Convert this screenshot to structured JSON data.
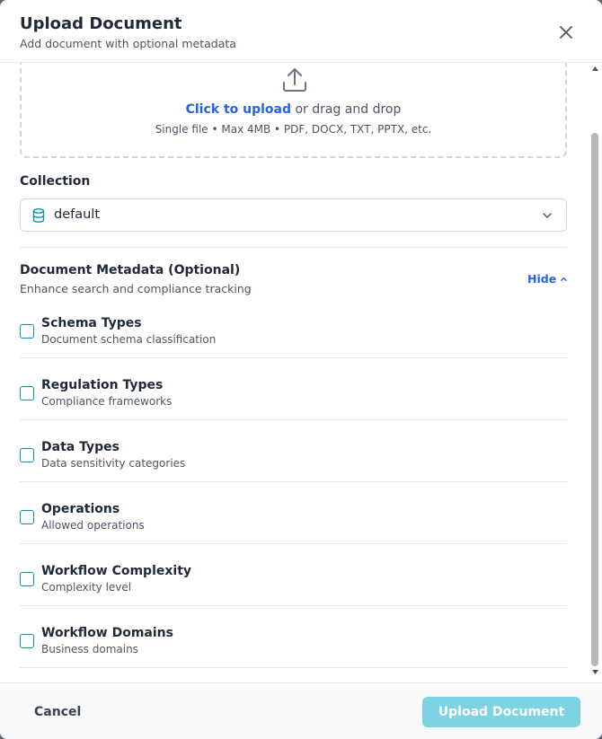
{
  "header": {
    "title": "Upload Document",
    "subtitle": "Add document with optional metadata"
  },
  "dropzone": {
    "link_text": "Click to upload",
    "rest_text": " or drag and drop",
    "hint": "Single file • Max 4MB • PDF, DOCX, TXT, PPTX, etc."
  },
  "collection": {
    "label": "Collection",
    "selected": "default"
  },
  "metadata": {
    "title": "Document Metadata (Optional)",
    "subtitle": "Enhance search and compliance tracking",
    "toggle_label": "Hide",
    "items": [
      {
        "name": "Schema Types",
        "desc": "Document schema classification",
        "checked": false
      },
      {
        "name": "Regulation Types",
        "desc": "Compliance frameworks",
        "checked": false
      },
      {
        "name": "Data Types",
        "desc": "Data sensitivity categories",
        "checked": false
      },
      {
        "name": "Operations",
        "desc": "Allowed operations",
        "checked": false
      },
      {
        "name": "Workflow Complexity",
        "desc": "Complexity level",
        "checked": false
      },
      {
        "name": "Workflow Domains",
        "desc": "Business domains",
        "checked": false
      }
    ]
  },
  "footer": {
    "cancel_label": "Cancel",
    "upload_label": "Upload Document"
  },
  "colors": {
    "accent": "#2563eb",
    "checkbox_border": "#0891b2",
    "upload_button_disabled": "#7dd3e3"
  },
  "icons": [
    "upload-icon",
    "close-icon",
    "database-icon",
    "chevron-down-icon",
    "chevron-up-icon"
  ]
}
